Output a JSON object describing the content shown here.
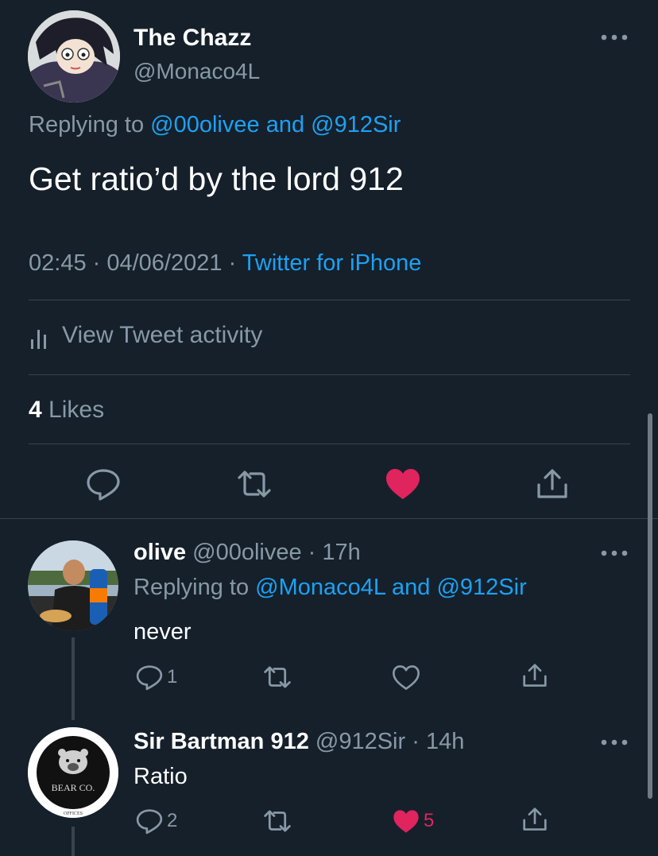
{
  "main_tweet": {
    "name": "The Chazz",
    "handle": "@Monaco4L",
    "replying_prefix": "Replying to",
    "replying_user1": "@00olivee",
    "replying_and": "and",
    "replying_user2": "@912Sir",
    "text": "Get ratio’d by the lord 912",
    "time": "02:45",
    "date": "04/06/2021",
    "client": "Twitter for iPhone",
    "activity_label": "View Tweet activity",
    "likes_count": "4",
    "likes_label": "Likes",
    "liked": true
  },
  "replies": [
    {
      "name": "olive",
      "handle": "@00olivee",
      "time": "17h",
      "replying_prefix": "Replying to",
      "replying_user1": "@Monaco4L",
      "replying_and": "and",
      "replying_user2": "@912Sir",
      "text": "never",
      "reply_count": "1",
      "retweet_count": "",
      "like_count": "",
      "liked": false
    },
    {
      "name": "Sir Bartman 912",
      "handle": "@912Sir",
      "time": "14h",
      "text": "Ratio",
      "reply_count": "2",
      "retweet_count": "",
      "like_count": "5",
      "liked": true,
      "avatar_text": "BEAR CO.",
      "avatar_subtext": "OFFICES"
    }
  ],
  "colors": {
    "background": "#15202b",
    "accent": "#1da1f2",
    "like": "#e0245e",
    "muted": "#8899a6",
    "divider": "#38444d"
  },
  "icons": [
    "more-icon",
    "activity-icon",
    "reply-icon",
    "retweet-icon",
    "heart-icon",
    "share-icon"
  ]
}
